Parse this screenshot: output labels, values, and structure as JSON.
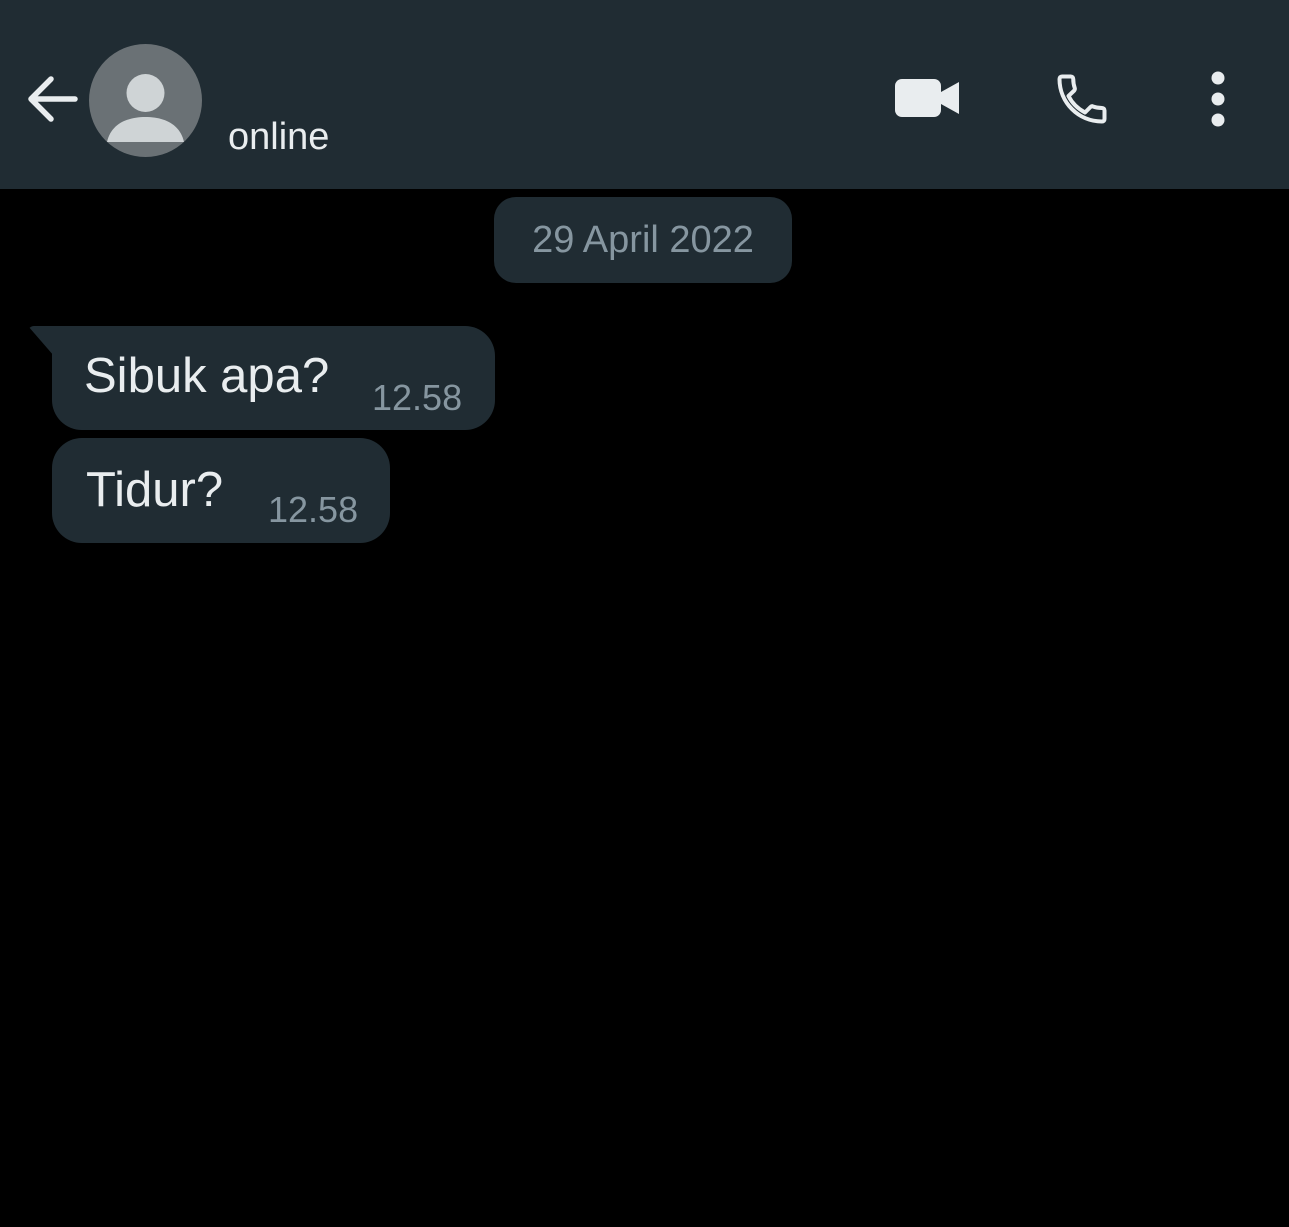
{
  "header": {
    "status": "online",
    "icons": {
      "back": "arrow-left-icon",
      "avatar": "default-avatar-icon",
      "video": "video-camera-icon",
      "call": "phone-icon",
      "menu": "more-vertical-icon"
    }
  },
  "chat": {
    "date_separator": "29 April 2022",
    "messages": [
      {
        "text": "Sibuk apa?",
        "time": "12.58",
        "direction": "incoming"
      },
      {
        "text": "Tidur?",
        "time": "12.58",
        "direction": "incoming"
      }
    ]
  },
  "colors": {
    "header_bg": "#202c33",
    "chat_bg": "#000000",
    "bubble_bg": "#202c33",
    "primary_text": "#e9edef",
    "secondary_text": "#8696a0",
    "avatar_bg": "#6a7175",
    "avatar_fg": "#cfd4d6"
  }
}
